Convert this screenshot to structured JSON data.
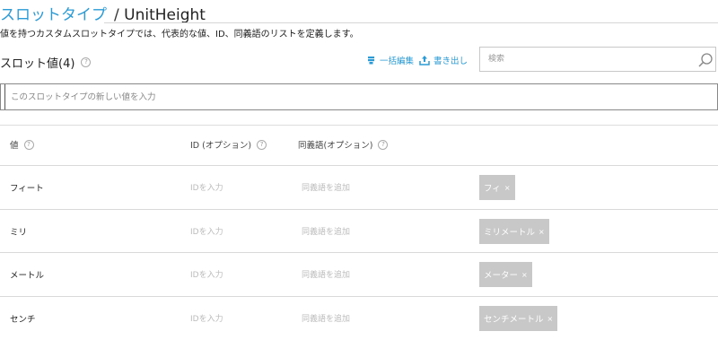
{
  "header": {
    "title_link": "スロットタイプ",
    "title_separator": "/",
    "title_name": "UnitHeight",
    "description": "値を持つカスタムスロットタイプでは、代表的な値、ID、同義語のリストを定義します。"
  },
  "slots": {
    "heading": "スロット値(4)",
    "help_glyph": "?",
    "bulk_edit_label": "一括編集",
    "export_label": "書き出し",
    "search_placeholder": "検索",
    "new_value_placeholder": "このスロットタイプの新しい値を入力"
  },
  "table": {
    "columns": [
      {
        "label": "値",
        "help": "?"
      },
      {
        "label": "ID (オプション)",
        "help": "?"
      },
      {
        "label": "同義語(オプション)",
        "help": "?"
      }
    ],
    "rows": [
      {
        "value": "フィート",
        "id_placeholder": "IDを入力",
        "synonym_placeholder": "同義語を追加",
        "synonym": "フィ",
        "remove": "×"
      },
      {
        "value": "ミリ",
        "id_placeholder": "IDを入力",
        "synonym_placeholder": "同義語を追加",
        "synonym": "ミリメートル",
        "remove": "×"
      },
      {
        "value": "メートル",
        "id_placeholder": "IDを入力",
        "synonym_placeholder": "同義語を追加",
        "synonym": "メーター",
        "remove": "×"
      },
      {
        "value": "センチ",
        "id_placeholder": "IDを入力",
        "synonym_placeholder": "同義語を追加",
        "synonym": "センチメートル",
        "remove": "×"
      }
    ]
  },
  "icons": {
    "bulk_edit": "bulk-edit-icon",
    "export": "upload-icon",
    "search": "search-icon"
  },
  "colors": {
    "accent": "#2a9bd6",
    "chip": "#c8c8c8"
  }
}
